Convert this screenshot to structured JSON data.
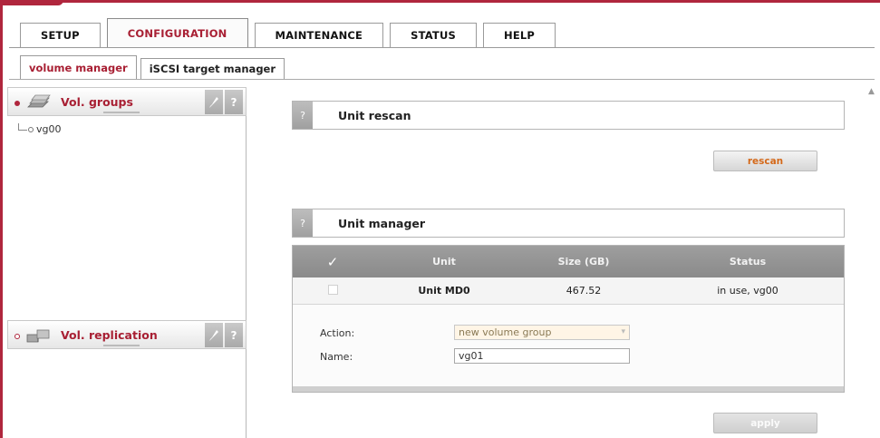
{
  "main_tabs": [
    {
      "label": "SETUP",
      "active": false
    },
    {
      "label": "CONFIGURATION",
      "active": true
    },
    {
      "label": "MAINTENANCE",
      "active": false
    },
    {
      "label": "STATUS",
      "active": false
    },
    {
      "label": "HELP",
      "active": false
    }
  ],
  "sub_tabs": [
    {
      "label": "volume manager",
      "active": true
    },
    {
      "label": "iSCSI target manager",
      "active": false
    }
  ],
  "sidebar": {
    "vol_groups": {
      "title": "Vol. groups",
      "icon": "volume-group-icon",
      "tool_icon": "wrench-icon",
      "help": "?",
      "items": [
        {
          "label": "vg00"
        }
      ]
    },
    "vol_replication": {
      "title": "Vol. replication",
      "icon": "replication-icon",
      "tool_icon": "wrench-icon",
      "help": "?"
    }
  },
  "unit_rescan": {
    "help": "?",
    "title": "Unit rescan",
    "button": "rescan"
  },
  "unit_manager": {
    "help": "?",
    "title": "Unit manager",
    "table": {
      "headers": {
        "check": "✓",
        "unit": "Unit",
        "size": "Size (GB)",
        "status": "Status"
      },
      "rows": [
        {
          "unit": "Unit MD0",
          "size": "467.52",
          "status": "in use, vg00",
          "checked": false
        }
      ]
    },
    "form": {
      "action_label": "Action:",
      "action_value": "new volume group",
      "name_label": "Name:",
      "name_value": "vg01"
    },
    "apply_button": "apply"
  },
  "colors": {
    "accent": "#a81f33",
    "frame": "#b0263d",
    "rescan_text": "#d4691a"
  }
}
